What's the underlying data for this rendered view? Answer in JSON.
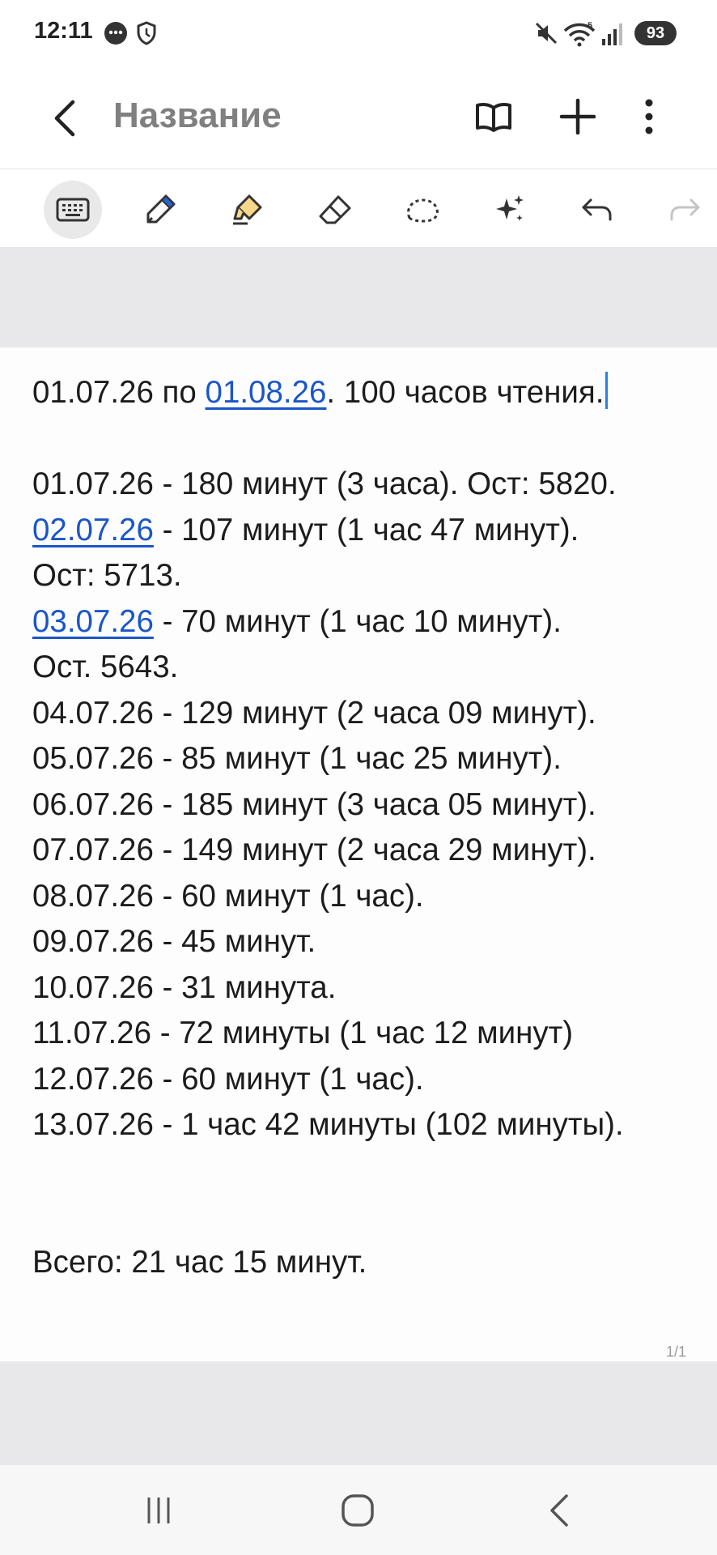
{
  "status_bar": {
    "time": "12:11",
    "icons": [
      "chat-bubble-icon",
      "shield-icon",
      "mute-icon",
      "wifi-icon",
      "signal-icon"
    ],
    "battery": "93"
  },
  "app_bar": {
    "title": "Название",
    "icons": [
      "back-icon",
      "book-icon",
      "add-icon",
      "more-vert-icon"
    ]
  },
  "toolbar": {
    "tools": [
      "keyboard-icon",
      "pen-icon",
      "highlighter-icon",
      "eraser-icon",
      "lasso-icon",
      "sparkle-icon",
      "undo-icon",
      "redo-icon"
    ],
    "active": "keyboard-icon"
  },
  "note": {
    "header_start": "01.07.26 по ",
    "header_link": "01.08.26",
    "header_end": ". 100 часов чтения.",
    "line_1": "01.07.26 - 180 минут (3 часа). Ост: 5820.",
    "line_2_link": "02.07.26",
    "line_2_rest": " - 107 минут (1 час 47 минут).",
    "line_3": "Ост: 5713.",
    "line_4_link": "03.07.26",
    "line_4_rest": " - 70 минут (1 час 10 минут).",
    "line_5": "Ост. 5643.",
    "line_6": "04.07.26 - 129 минут (2 часа 09 минут).",
    "line_7": "05.07.26 - 85 минут (1 час 25 минут).",
    "line_8": "06.07.26 - 185 минут (3 часа 05 минут).",
    "line_9": "07.07.26 - 149 минут (2 часа 29 минут).",
    "line_10": "08.07.26 - 60 минут (1 час).",
    "line_11": "09.07.26 - 45 минут.",
    "line_12": "10.07.26 - 31 минута.",
    "line_13": "11.07.26 - 72 минуты (1 час 12 минут)",
    "line_14": "12.07.26 - 60 минут (1 час).",
    "line_15": "13.07.26 - 1 час 42 минуты (102 минуты).",
    "total": "Всего: 21 час 15 минут."
  },
  "page_indicator": "1/1",
  "nav_bar": {
    "buttons": [
      "recent-apps-icon",
      "home-icon",
      "nav-back-icon"
    ]
  },
  "colors": {
    "link": "#1a56c9",
    "cursor": "#2b7de9",
    "title": "#808080",
    "background_gray": "#e8e8ea"
  }
}
